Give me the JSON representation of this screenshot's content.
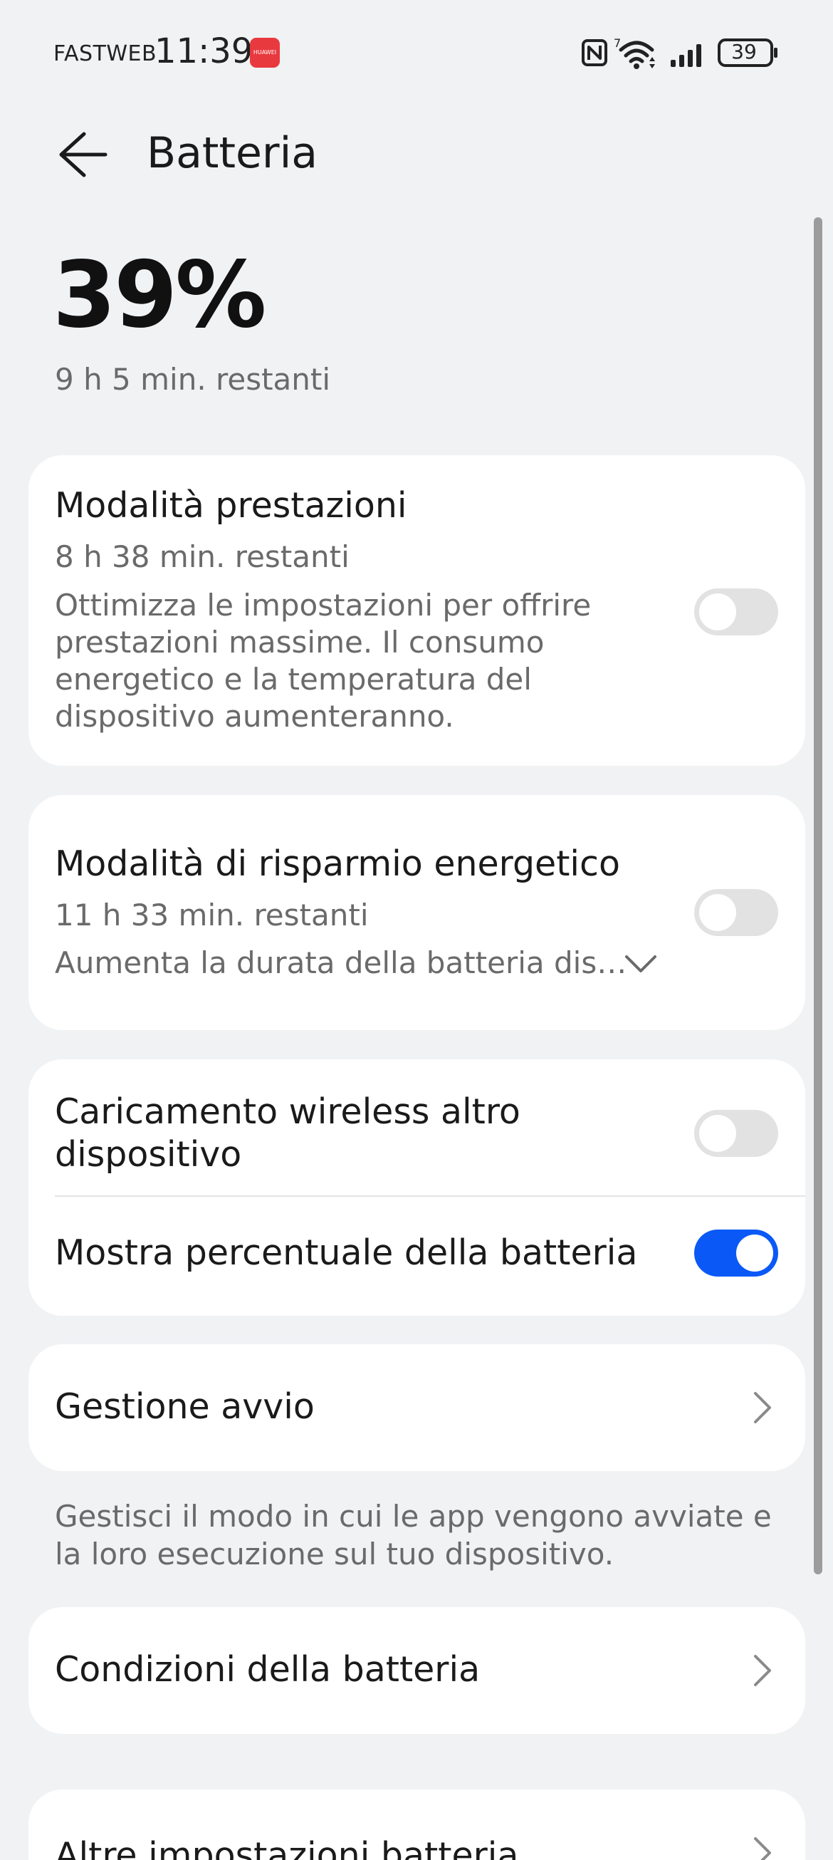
{
  "status_bar": {
    "carrier": "FASTWEB",
    "time": "11:39",
    "app_badge": "HUAWEI",
    "network_sup": "7",
    "battery_level": "39"
  },
  "header": {
    "title": "Batteria"
  },
  "battery": {
    "percent": "39%",
    "remaining": "9 h 5 min. restanti"
  },
  "performance_mode": {
    "title": "Modalità prestazioni",
    "remaining": "8 h 38 min. restanti",
    "description": "Ottimizza le impostazioni per offrire prestazioni massime. Il consumo energetico e la temperatura del dispositivo aumenteranno.",
    "enabled": false
  },
  "power_saving": {
    "title": "Modalità di risparmio energetico",
    "remaining": "11 h 33 min. restanti",
    "description": "Aumenta la durata della batteria dis…",
    "enabled": false
  },
  "wireless_reverse": {
    "title_line1": "Caricamento wireless altro",
    "title_line2": "dispositivo",
    "enabled": false
  },
  "show_percentage": {
    "title": "Mostra percentuale della batteria",
    "enabled": true
  },
  "startup_management": {
    "title": "Gestione avvio",
    "footnote": "Gestisci il modo in cui le app vengono avviate e la loro esecuzione sul tuo dispositivo."
  },
  "battery_health": {
    "title": "Condizioni della batteria"
  },
  "more_settings": {
    "title": "Altre impostazioni batteria"
  },
  "colors": {
    "accent": "#0a59f7",
    "background": "#f1f2f4",
    "card": "#ffffff",
    "secondary_text": "#6a6a6a"
  }
}
